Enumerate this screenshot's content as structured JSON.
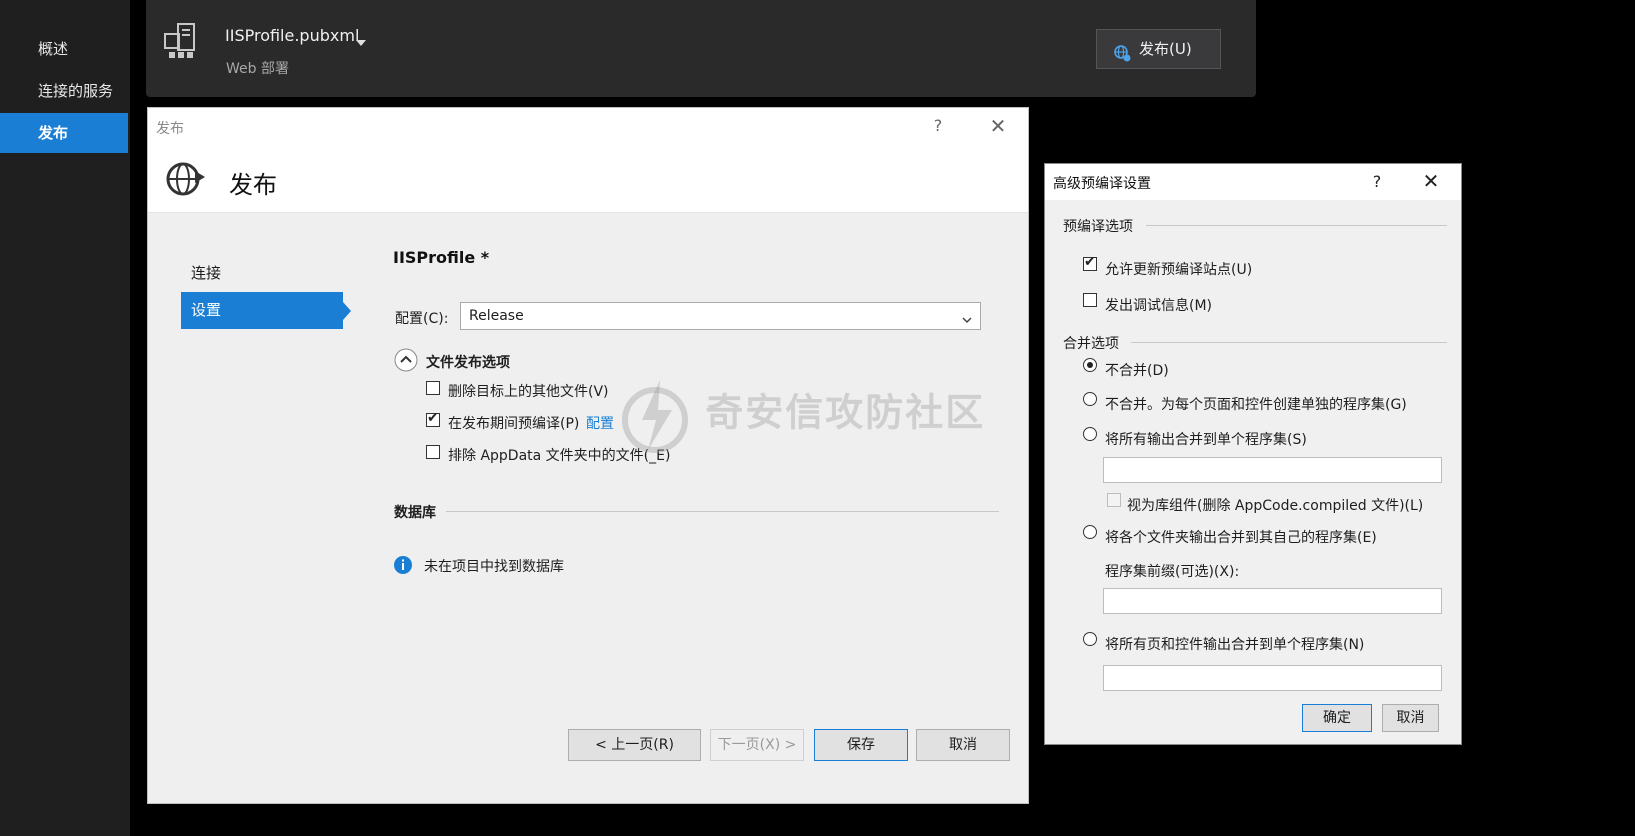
{
  "left_nav": {
    "items": [
      {
        "label": "概述",
        "active": false
      },
      {
        "label": "连接的服务",
        "active": false
      },
      {
        "label": "发布",
        "active": true
      }
    ]
  },
  "top_bar": {
    "profile_name": "IISProfile.pubxml",
    "profile_subtitle": "Web 部署",
    "publish_button": "发布(U)"
  },
  "publish_dialog": {
    "window_title": "发布",
    "help": "?",
    "header_title": "发布",
    "steps": [
      "连接",
      "设置"
    ],
    "active_step": "设置",
    "profile_heading": "IISProfile *",
    "config_label": "配置(C):",
    "config_value": "Release",
    "file_options_title": "文件发布选项",
    "file_options": [
      {
        "label": "删除目标上的其他文件(V)",
        "checked": false
      },
      {
        "label": "在发布期间预编译(P)",
        "checked": true,
        "link": "配置"
      },
      {
        "label": "排除 AppData 文件夹中的文件(_E)",
        "checked": false
      }
    ],
    "database_title": "数据库",
    "database_info": "未在项目中找到数据库",
    "buttons": {
      "prev": "< 上一页(R)",
      "next": "下一页(X) >",
      "save": "保存",
      "cancel": "取消"
    }
  },
  "advanced_dialog": {
    "title": "高级预编译设置",
    "help": "?",
    "precompile_group": "预编译选项",
    "precompile_options": [
      {
        "label": "允许更新预编译站点(U)",
        "checked": true
      },
      {
        "label": "发出调试信息(M)",
        "checked": false
      }
    ],
    "merge_group": "合并选项",
    "merge_options": [
      {
        "label": "不合并(D)",
        "selected": true
      },
      {
        "label": "不合并。为每个页面和控件创建单独的程序集(G)",
        "selected": false
      },
      {
        "label": "将所有输出合并到单个程序集(S)",
        "selected": false
      },
      {
        "label": "将各个文件夹输出合并到其自己的程序集(E)",
        "selected": false
      },
      {
        "label": "将所有页和控件输出合并到单个程序集(N)",
        "selected": false
      }
    ],
    "library_component_label": "视为库组件(删除 AppCode.compiled 文件)(L)",
    "prefix_label": "程序集前缀(可选)(X):",
    "ok": "确定",
    "cancel": "取消"
  },
  "watermark": "奇安信攻防社区",
  "colors": {
    "accent": "#1a7fd4",
    "dark_bg": "#1f1f1f",
    "panel_bg": "#2a2a2a",
    "dialog_bg": "#efefef",
    "link": "#1a7fd4"
  }
}
